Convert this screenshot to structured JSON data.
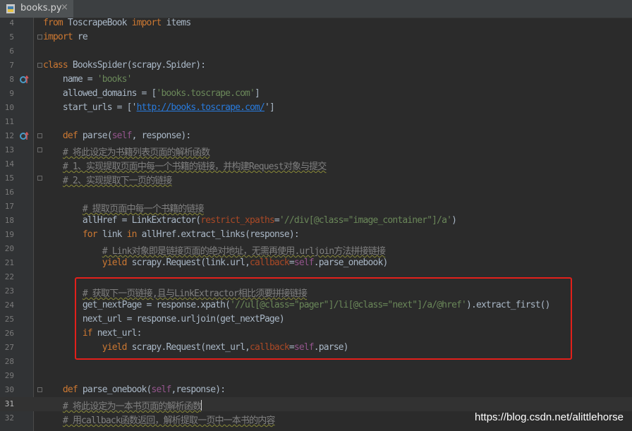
{
  "tab": {
    "filename": "books.py",
    "close_symbol": "×"
  },
  "lines": [
    {
      "n": "4",
      "t": [
        [
          "from",
          "kw"
        ],
        [
          " ToscrapeBook ",
          ""
        ],
        [
          "import",
          "kw"
        ],
        [
          " items",
          ""
        ]
      ]
    },
    {
      "n": "5",
      "t": [
        [
          "import",
          "kw"
        ],
        [
          " re",
          ""
        ]
      ]
    },
    {
      "n": "6",
      "t": []
    },
    {
      "n": "7",
      "t": [
        [
          "class",
          "kw"
        ],
        [
          " BooksSpider(scrapy.Spider):",
          ""
        ]
      ]
    },
    {
      "n": "8",
      "t": [
        [
          "    name = ",
          ""
        ],
        [
          "'books'",
          "str"
        ]
      ]
    },
    {
      "n": "9",
      "t": [
        [
          "    allowed_domains = [",
          ""
        ],
        [
          "'books.toscrape.com'",
          "str"
        ],
        [
          "]",
          ""
        ]
      ]
    },
    {
      "n": "10",
      "t": [
        [
          "    start_urls = [",
          ""
        ],
        [
          "'",
          ""
        ],
        [
          "http://books.toscrape.com/",
          "link"
        ],
        [
          "'",
          ""
        ],
        [
          "]",
          ""
        ]
      ]
    },
    {
      "n": "11",
      "t": []
    },
    {
      "n": "12",
      "t": [
        [
          "    ",
          ""
        ],
        [
          "def",
          "kw"
        ],
        [
          " parse(",
          ""
        ],
        [
          "self",
          "self"
        ],
        [
          ", response):",
          ""
        ]
      ]
    },
    {
      "n": "13",
      "t": [
        [
          "    ",
          ""
        ],
        [
          "# 将此设定为书籍列表页面的解析函数",
          "cm"
        ]
      ]
    },
    {
      "n": "14",
      "t": [
        [
          "    ",
          ""
        ],
        [
          "# 1、实现提取页面中每一个书籍的链接，并构建Request对象与提交",
          "cm"
        ]
      ]
    },
    {
      "n": "15",
      "t": [
        [
          "    ",
          ""
        ],
        [
          "# 2、实现提取下一页的链接",
          "cm"
        ]
      ]
    },
    {
      "n": "16",
      "t": []
    },
    {
      "n": "17",
      "t": [
        [
          "        ",
          ""
        ],
        [
          "# 提取页面中每一个书籍的链接",
          "cm"
        ]
      ]
    },
    {
      "n": "18",
      "t": [
        [
          "        allHref = LinkExtractor(",
          ""
        ],
        [
          "restrict_xpaths",
          "param"
        ],
        [
          "=",
          ""
        ],
        [
          "'//div[@class=\"image_container\"]/a'",
          "str"
        ],
        [
          ")",
          ""
        ]
      ]
    },
    {
      "n": "19",
      "t": [
        [
          "        ",
          ""
        ],
        [
          "for",
          "kw"
        ],
        [
          " link ",
          ""
        ],
        [
          "in",
          "kw"
        ],
        [
          " allHref.extract_links(response):",
          ""
        ]
      ]
    },
    {
      "n": "20",
      "t": [
        [
          "            ",
          ""
        ],
        [
          "# Link对象即是链接页面的绝对地址，无需再使用.urljoin方法拼接链接",
          "cm"
        ]
      ]
    },
    {
      "n": "21",
      "t": [
        [
          "            ",
          ""
        ],
        [
          "yield",
          "kw"
        ],
        [
          " scrapy.Request(link.url,",
          ""
        ],
        [
          "callback",
          "param"
        ],
        [
          "=",
          ""
        ],
        [
          "self",
          "self"
        ],
        [
          ".parse_onebook)",
          ""
        ]
      ]
    },
    {
      "n": "22",
      "t": []
    },
    {
      "n": "23",
      "t": [
        [
          "        ",
          ""
        ],
        [
          "# 获取下一页链接,且与LinkExtractor相比须要拼接链接",
          "cm"
        ]
      ]
    },
    {
      "n": "24",
      "t": [
        [
          "        get_nextPage = response.xpath(",
          ""
        ],
        [
          "'//ul[@class=\"pager\"]/li[@class=\"next\"]/a/@href'",
          "str"
        ],
        [
          ").extract_first()",
          ""
        ]
      ]
    },
    {
      "n": "25",
      "t": [
        [
          "        next_url = response.urljoin(get_nextPage)",
          ""
        ]
      ]
    },
    {
      "n": "26",
      "t": [
        [
          "        ",
          ""
        ],
        [
          "if",
          "kw"
        ],
        [
          " next_url:",
          ""
        ]
      ]
    },
    {
      "n": "27",
      "t": [
        [
          "            ",
          ""
        ],
        [
          "yield",
          "kw"
        ],
        [
          " scrapy.Request(next_url,",
          ""
        ],
        [
          "callback",
          "param"
        ],
        [
          "=",
          ""
        ],
        [
          "self",
          "self"
        ],
        [
          ".parse)",
          ""
        ]
      ]
    },
    {
      "n": "28",
      "t": []
    },
    {
      "n": "29",
      "t": []
    },
    {
      "n": "30",
      "t": [
        [
          "    ",
          ""
        ],
        [
          "def",
          "kw"
        ],
        [
          " parse_onebook(",
          ""
        ],
        [
          "self",
          "self"
        ],
        [
          ",response):",
          ""
        ]
      ]
    },
    {
      "n": "31",
      "t": [
        [
          "    ",
          ""
        ],
        [
          "# 将此设定为一本书页面的解析函数",
          "cm"
        ]
      ]
    },
    {
      "n": "32",
      "t": [
        [
          "    ",
          ""
        ],
        [
          "# 用callback函数返回，解析提取一页中一本书的内容",
          "cm"
        ]
      ]
    }
  ],
  "current_line": "31",
  "watermark": "https://blog.csdn.net/alittlehorse",
  "colors": {
    "keyword": "#cc7832",
    "string": "#6a8759",
    "comment": "#808080",
    "self": "#94558d",
    "param": "#aa4926",
    "link": "#287bde",
    "highlight": "#e2201b"
  },
  "icons": [
    "python-file-icon",
    "override-method-icon",
    "fold-marker-icon"
  ]
}
